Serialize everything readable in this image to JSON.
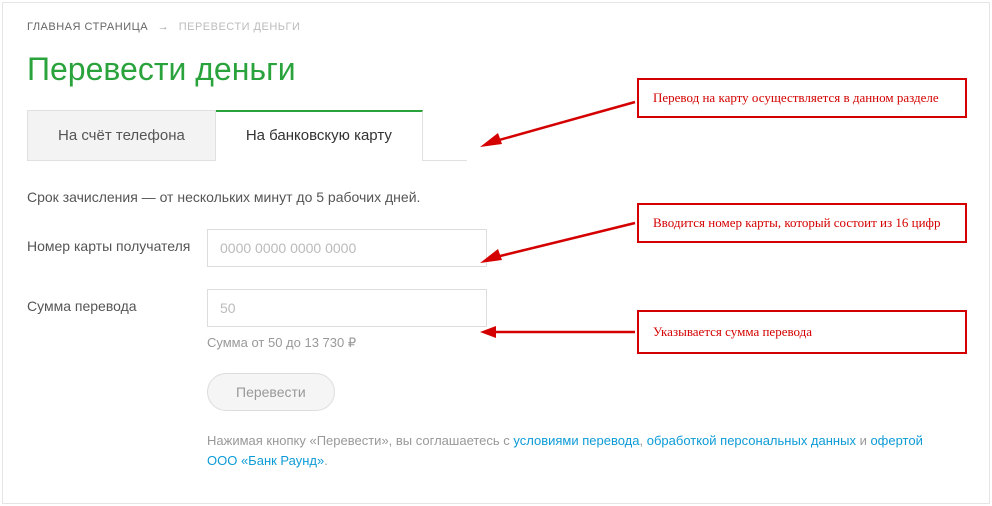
{
  "breadcrumb": {
    "home": "ГЛАВНАЯ СТРАНИЦА",
    "arrow": "→",
    "current": "ПЕРЕВЕСТИ ДЕНЬГИ"
  },
  "title": "Перевести деньги",
  "tabs": {
    "phone": "На счёт телефона",
    "card": "На банковскую карту"
  },
  "info": "Срок зачисления — от нескольких минут до 5 рабочих дней.",
  "form": {
    "card_label": "Номер карты получателя",
    "card_placeholder": "0000 0000 0000 0000",
    "amount_label": "Сумма перевода",
    "amount_placeholder": "50",
    "amount_hint": "Сумма от 50 до 13 730 ₽",
    "submit": "Перевести"
  },
  "legal": {
    "prefix": "Нажимая кнопку «Перевести», вы соглашаетесь с ",
    "link1": "условиями перевода",
    "sep1": ", ",
    "link2": "обработкой персональных данных",
    "sep2": " и ",
    "link3": "офертой ООО «Банк Раунд»",
    "suffix": "."
  },
  "callouts": {
    "c1": "Перевод на карту осуществляется в данном разделе",
    "c2": "Вводится номер карты, который состоит из 16 цифр",
    "c3": "Указывается сумма перевода"
  }
}
